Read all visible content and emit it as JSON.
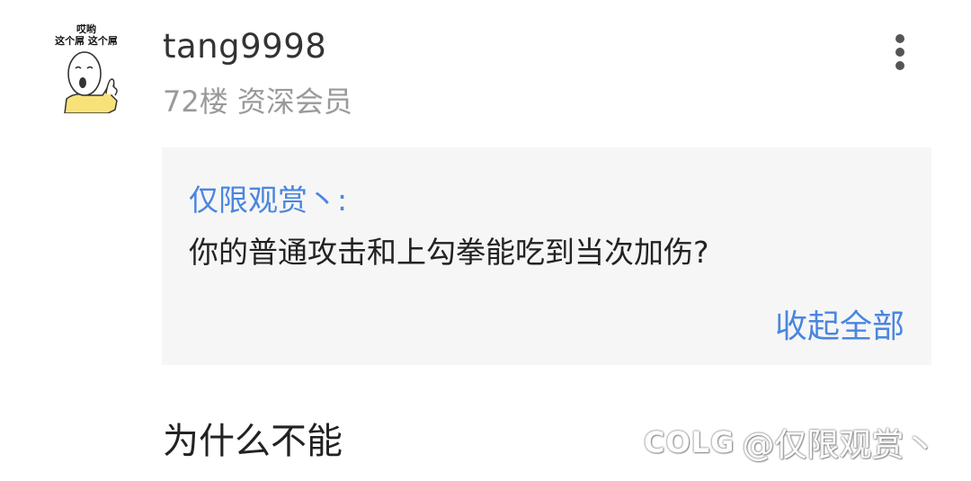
{
  "post": {
    "avatar": {
      "caption_top": "哎哟",
      "caption_bottom": "这个屌 这个屌"
    },
    "username": "tang9998",
    "meta": "72楼 资深会员",
    "quote": {
      "author": "仅限观赏丶:",
      "text": "你的普通攻击和上勾拳能吃到当次加伤?",
      "collapse_label": "收起全部"
    },
    "reply_text": "为什么不能"
  },
  "icons": {
    "more": "more-vertical-icon"
  },
  "watermark": {
    "logo": "COLG",
    "handle": "@仅限观赏丶"
  },
  "colors": {
    "link": "#4a86e0",
    "quote_bg": "#f6f6f6",
    "meta_gray": "#9a9a9a"
  }
}
